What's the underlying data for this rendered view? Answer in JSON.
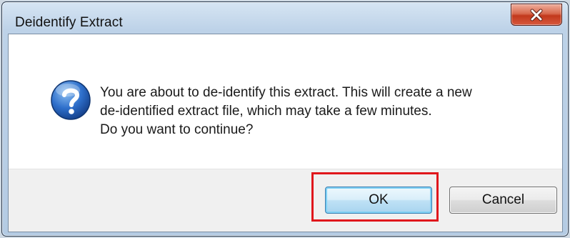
{
  "dialog": {
    "title": "Deidentify Extract",
    "icon": "question-icon",
    "message_lines": [
      "You are about to de-identify this extract. This will create a new",
      "de-identified extract file, which may take a few minutes.",
      "Do you want to continue?"
    ],
    "buttons": {
      "ok_label": "OK",
      "cancel_label": "Cancel"
    },
    "close_icon": "close-icon"
  },
  "colors": {
    "highlight": "#e0171c",
    "close_button": "#c2391c",
    "icon_blue": "#1f5db8"
  }
}
